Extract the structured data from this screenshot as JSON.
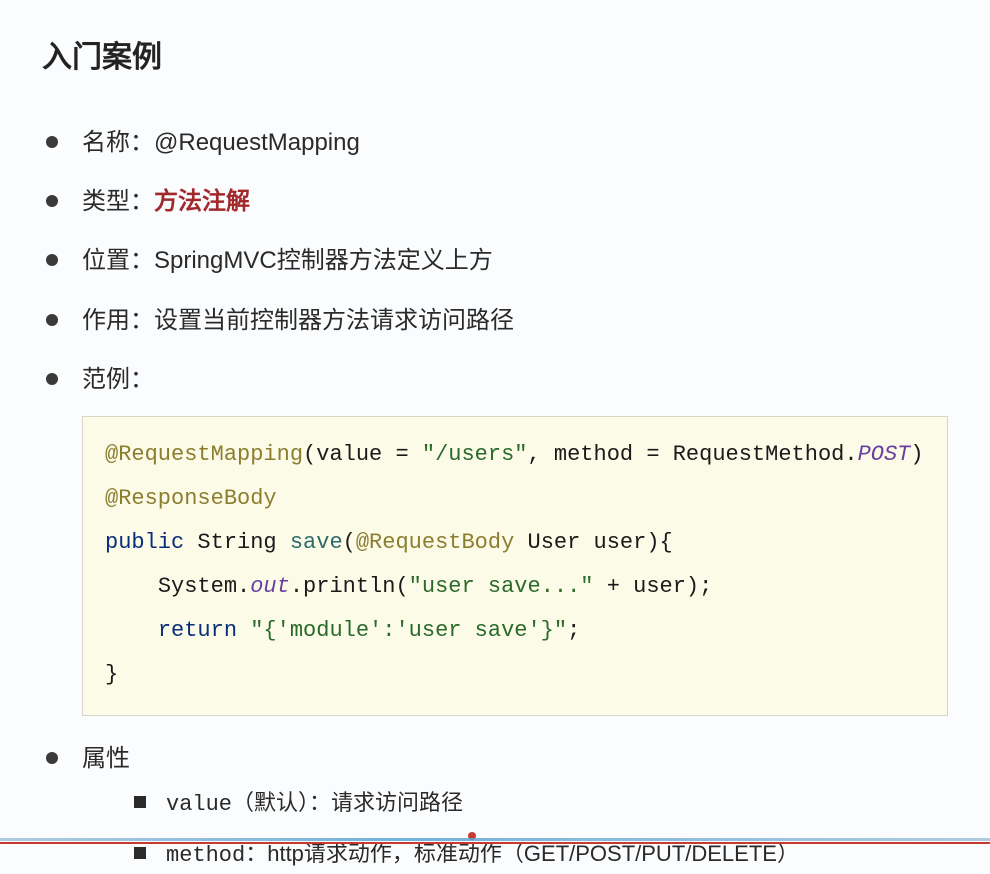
{
  "title": "入门案例",
  "items": {
    "name_label": "名称：",
    "name_value": "@RequestMapping",
    "type_label": "类型：",
    "type_value": "方法注解",
    "position_label": "位置：",
    "position_value": "SpringMVC控制器方法定义上方",
    "purpose_label": "作用：",
    "purpose_value": "设置当前控制器方法请求访问路径",
    "example_label": "范例：",
    "attr_label": "属性"
  },
  "code": {
    "ann1_name": "@RequestMapping",
    "ann1_open": "(value = ",
    "ann1_val": "\"/users\"",
    "ann1_mid": ", method = RequestMethod.",
    "ann1_const": "POST",
    "ann1_close": ")",
    "ann2": "@ResponseBody",
    "kw_public": "public",
    "type_string": " String ",
    "m_save": "save",
    "m_save_open": "(",
    "ann_reqbody": "@RequestBody",
    "m_save_args": " User user){",
    "indent": "    ",
    "sys": "System.",
    "out": "out",
    "println": ".println(",
    "str_user_save": "\"user save...\"",
    "plus_user": " + user);",
    "kw_return": "return",
    "ret_sp": " ",
    "ret_str": "\"{'module':'user save'}\"",
    "ret_semi": ";",
    "close_brace": "}"
  },
  "attrs": {
    "value_key": "value",
    "value_note": "（默认）：请求访问路径",
    "method_key": "method",
    "method_note": "：http请求动作，标准动作（GET/POST/PUT/DELETE）"
  }
}
